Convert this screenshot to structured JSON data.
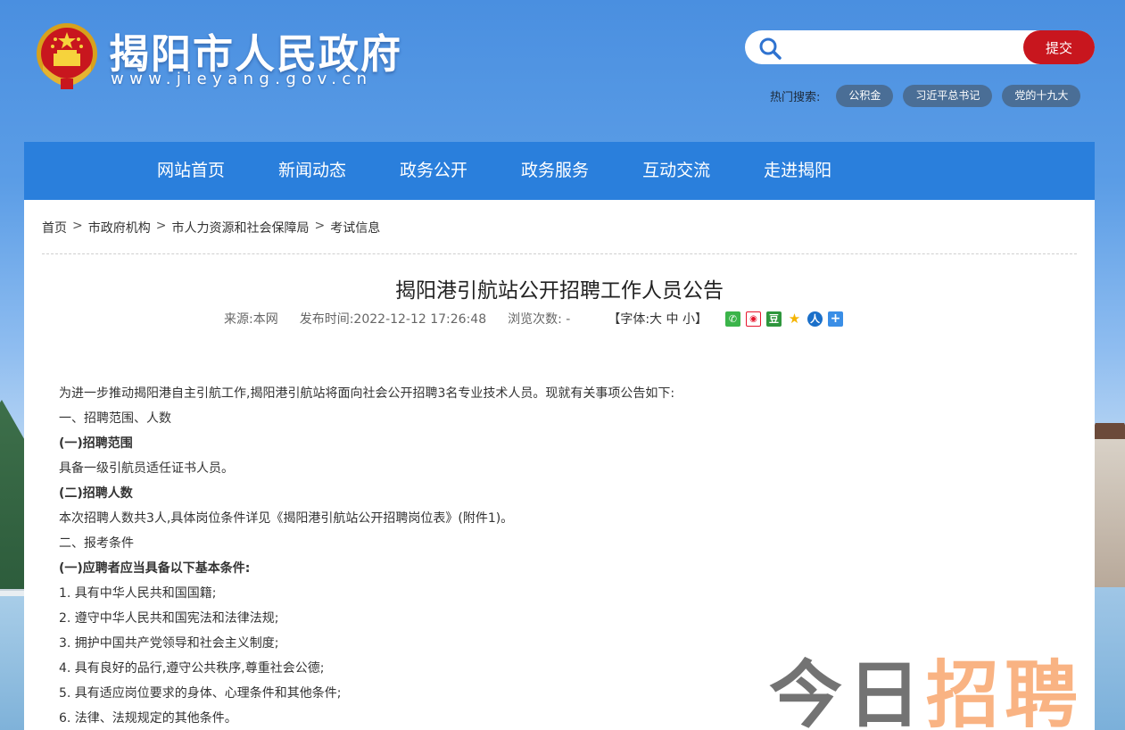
{
  "header": {
    "site_title": "揭阳市人民政府",
    "site_url": "www.jieyang.gov.cn",
    "search": {
      "placeholder": "",
      "submit_label": "提交"
    },
    "hot_search": {
      "label": "热门搜索:",
      "tags": [
        "公积金",
        "习近平总书记",
        "党的十九大"
      ]
    }
  },
  "nav": {
    "items": [
      "网站首页",
      "新闻动态",
      "政务公开",
      "政务服务",
      "互动交流",
      "走进揭阳"
    ]
  },
  "breadcrumb": {
    "items": [
      "首页",
      "市政府机构",
      "市人力资源和社会保障局",
      "考试信息"
    ],
    "separator": ">"
  },
  "article": {
    "title": "揭阳港引航站公开招聘工作人员公告",
    "meta": {
      "source": "来源:本网",
      "publish_time": "发布时间:2022-12-12 17:26:48",
      "views": "浏览次数:  -",
      "font_size": "【字体:大 中 小】"
    },
    "share_icons": [
      "wechat-icon",
      "weibo-icon",
      "douban-icon",
      "qzone-icon",
      "renren-icon",
      "more-share-icon"
    ],
    "paragraphs": [
      {
        "text": "为进一步推动揭阳港自主引航工作,揭阳港引航站将面向社会公开招聘3名专业技术人员。现就有关事项公告如下:",
        "bold": false
      },
      {
        "text": "一、招聘范围、人数",
        "bold": false
      },
      {
        "text": "(一)招聘范围",
        "bold": true
      },
      {
        "text": "具备一级引航员适任证书人员。",
        "bold": false
      },
      {
        "text": "(二)招聘人数",
        "bold": true
      },
      {
        "text": "本次招聘人数共3人,具体岗位条件详见《揭阳港引航站公开招聘岗位表》(附件1)。",
        "bold": false
      },
      {
        "text": "二、报考条件",
        "bold": false
      },
      {
        "text": "(一)应聘者应当具备以下基本条件:",
        "bold": true
      },
      {
        "text": "1. 具有中华人民共和国国籍;",
        "bold": false
      },
      {
        "text": "2. 遵守中华人民共和国宪法和法律法规;",
        "bold": false
      },
      {
        "text": "3. 拥护中国共产党领导和社会主义制度;",
        "bold": false
      },
      {
        "text": "4. 具有良好的品行,遵守公共秩序,尊重社会公德;",
        "bold": false
      },
      {
        "text": "5. 具有适应岗位要求的身体、心理条件和其他条件;",
        "bold": false
      },
      {
        "text": "6. 法律、法规规定的其他条件。",
        "bold": false
      }
    ]
  },
  "watermark": {
    "part1": "今日",
    "part2": "招聘"
  },
  "colors": {
    "nav_bg": "#2a7fdc",
    "submit_bg": "#c8161e",
    "hot_tag_bg": "#4a6e96"
  }
}
